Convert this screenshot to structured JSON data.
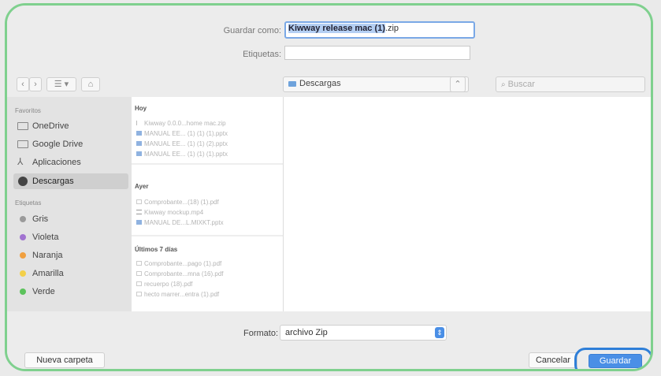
{
  "header": {
    "save_as_label": "Guardar como:",
    "filename": "Kiwway release mac (1).zip",
    "filename_selected": "Kiwway release mac (1)",
    "filename_ext": ".zip",
    "tags_label": "Etiquetas:",
    "tags_value": ""
  },
  "nav": {
    "back": "‹",
    "forward": "›",
    "view": "☰ ▾",
    "newfolder": "⌂",
    "location": "Descargas",
    "search_placeholder": "Buscar"
  },
  "sidebar": {
    "favorites_heading": "Favoritos",
    "favorites": [
      {
        "label": "OneDrive",
        "icon": "folder-icon"
      },
      {
        "label": "Google Drive",
        "icon": "folder-icon"
      },
      {
        "label": "Aplicaciones",
        "icon": "apps-icon"
      },
      {
        "label": "Descargas",
        "icon": "download-icon",
        "selected": true
      }
    ],
    "tags_heading": "Etiquetas",
    "tags": [
      {
        "label": "Gris",
        "color": "#9a9a9a"
      },
      {
        "label": "Violeta",
        "color": "#a173d0"
      },
      {
        "label": "Naranja",
        "color": "#f0a040"
      },
      {
        "label": "Amarilla",
        "color": "#f3d04a"
      },
      {
        "label": "Verde",
        "color": "#5cc35c"
      }
    ]
  },
  "files": {
    "sections": [
      {
        "heading": "Hoy",
        "items": [
          {
            "name": "Kiwway 0.0.0...home mac.zip",
            "icon": "zip-icon"
          },
          {
            "name": "MANUAL EE... (1) (1) (1).pptx",
            "icon": "doc-icon"
          },
          {
            "name": "MANUAL EE... (1) (1) (2).pptx",
            "icon": "doc-icon"
          },
          {
            "name": "MANUAL EE... (1) (1) (1).pptx",
            "icon": "doc-icon"
          }
        ]
      },
      {
        "heading": "Ayer",
        "items": [
          {
            "name": "Comprobante...(18) (1).pdf",
            "icon": "pdf-icon"
          },
          {
            "name": "Kiwway mockup.mp4",
            "icon": "video-icon"
          },
          {
            "name": "MANUAL DE...L.MIXKT.pptx",
            "icon": "doc-icon"
          }
        ]
      },
      {
        "heading": "Últimos 7 días",
        "items": [
          {
            "name": "Comprobante...pago (1).pdf",
            "icon": "pdf-icon"
          },
          {
            "name": "Comprobante...mna (16).pdf",
            "icon": "pdf-icon"
          },
          {
            "name": "recuerpo (18).pdf",
            "icon": "pdf-icon"
          },
          {
            "name": "hecto marrer...entra (1).pdf",
            "icon": "pdf-icon"
          }
        ]
      }
    ]
  },
  "footer": {
    "format_label": "Formato:",
    "format_value": "archivo Zip",
    "new_folder": "Nueva carpeta",
    "cancel": "Cancelar",
    "save": "Guardar"
  },
  "colors": {
    "frame_highlight": "#7fd08e",
    "save_button_highlight": "#2f7fd8",
    "save_button": "#4a8fe6",
    "selection": "#b4cff3"
  }
}
